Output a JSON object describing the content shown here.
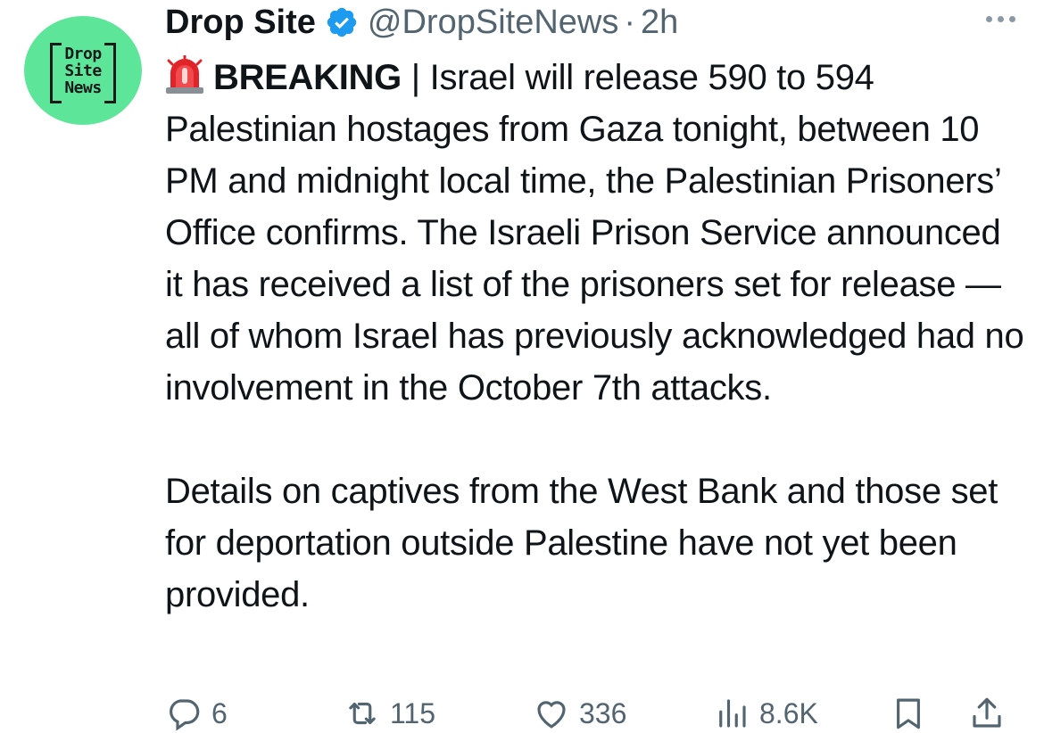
{
  "tweet": {
    "author_name": "Drop Site",
    "handle": "@DropSiteNews",
    "separator": "·",
    "time": "2h",
    "avatar_text": [
      "Drop",
      "Site",
      "News"
    ],
    "breaking_label": "BREAKING",
    "breaking_rest": " | Israel will release 590 to 594 Palestinian hostages from Gaza tonight, between 10 PM and midnight local time, the Palestinian Prisoners’ Office confirms. The Israeli Prison Service announced it has received a list of the prisoners set for release — all of whom Israel has previously acknowledged had no involvement in the October 7th attacks.",
    "paragraph2": "Details on captives from the West Bank and those set for deportation outside Palestine have not yet been provided."
  },
  "actions": {
    "replies": "6",
    "retweets": "115",
    "likes": "336",
    "views": "8.6K"
  },
  "icons": {
    "verified": "verified-badge-icon",
    "siren": "rotating-light-emoji",
    "more": "more-horizontal-icon",
    "reply": "reply-icon",
    "retweet": "retweet-icon",
    "like": "heart-icon",
    "views": "views-chart-icon",
    "bookmark": "bookmark-icon",
    "share": "share-icon"
  },
  "colors": {
    "avatar_bg": "#5de69a",
    "verified": "#1d9bf0",
    "secondary_text": "#536471",
    "primary_text": "#0f1419"
  }
}
